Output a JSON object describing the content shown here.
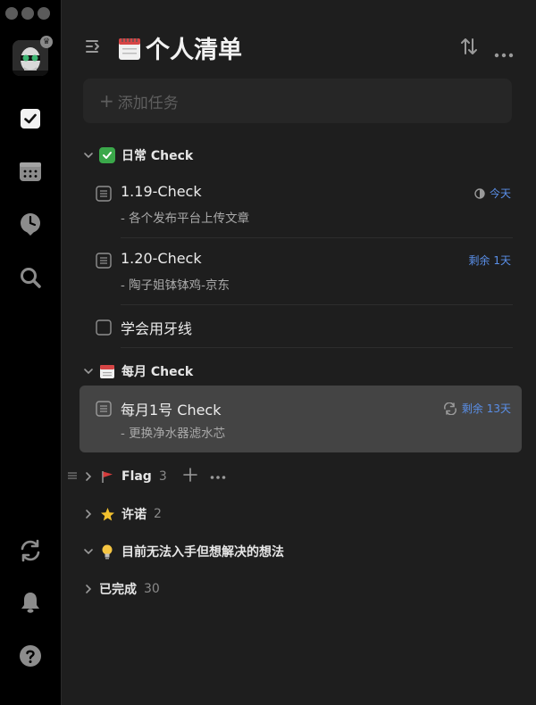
{
  "sidebar": {
    "items": [
      {
        "icon": "checkbox-icon",
        "active": true
      },
      {
        "icon": "calendar-icon",
        "active": false
      },
      {
        "icon": "clock-icon",
        "active": false
      },
      {
        "icon": "search-icon",
        "active": false
      },
      {
        "icon": "sync-icon",
        "active": false
      },
      {
        "icon": "bell-icon",
        "active": false
      },
      {
        "icon": "help-icon",
        "active": false
      }
    ]
  },
  "header": {
    "title": "个人清单"
  },
  "add_task": {
    "placeholder": "添加任务"
  },
  "sections": [
    {
      "name": "日常 Check",
      "expanded": true,
      "tasks": [
        {
          "title": "1.19-Check",
          "desc": "- 各个发布平台上传文章",
          "due": "今天"
        },
        {
          "title": "1.20-Check",
          "desc": "- 陶子姐钵钵鸡-京东",
          "due": "剩余 1天"
        },
        {
          "title": "学会用牙线",
          "desc": "",
          "due": ""
        }
      ]
    },
    {
      "name": "每月 Check",
      "expanded": true,
      "tasks": [
        {
          "title": "每月1号 Check",
          "desc": "- 更换净水器滤水芯",
          "due": "剩余 13天"
        }
      ]
    },
    {
      "name": "Flag",
      "count": "3",
      "expanded": false
    },
    {
      "name": "许诺",
      "count": "2",
      "expanded": false
    },
    {
      "name": "目前无法入手但想解决的想法",
      "expanded": true
    },
    {
      "name": "已完成",
      "count": "30",
      "expanded": false
    }
  ],
  "colors": {
    "accent_blue": "#5a8fe8",
    "background": "#1e1e1e",
    "sidebar": "#000000",
    "selected_row": "#444444"
  }
}
